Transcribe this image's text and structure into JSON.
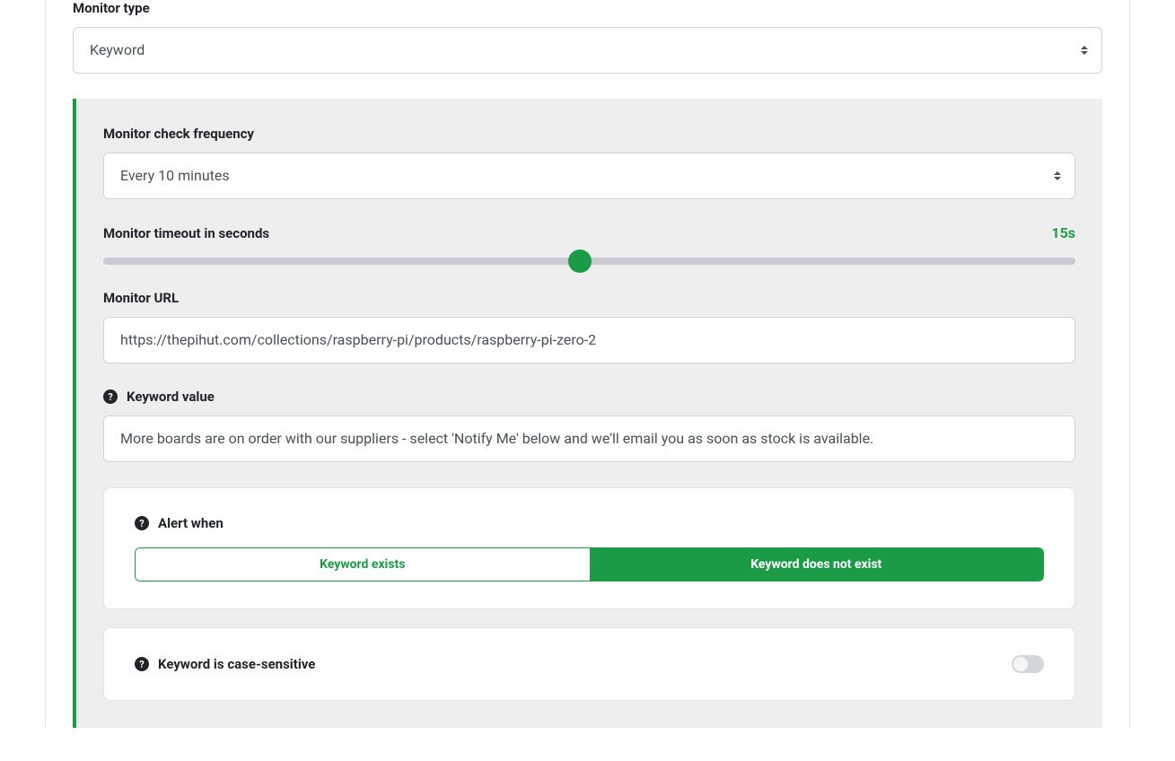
{
  "monitor_type": {
    "label": "Monitor type",
    "value": "Keyword"
  },
  "frequency": {
    "label": "Monitor check frequency",
    "value": "Every 10 minutes"
  },
  "timeout": {
    "label": "Monitor timeout in seconds",
    "value_display": "15s",
    "percent": 49
  },
  "url": {
    "label": "Monitor URL",
    "value": "https://thepihut.com/collections/raspberry-pi/products/raspberry-pi-zero-2"
  },
  "keyword": {
    "label": "Keyword value",
    "value": "More boards are on order with our suppliers - select 'Notify Me' below and we'll email you as soon as stock is available."
  },
  "alert_when": {
    "label": "Alert when",
    "option_exists": "Keyword exists",
    "option_not_exist": "Keyword does not exist",
    "selected": "not_exist"
  },
  "case_sensitive": {
    "label": "Keyword is case-sensitive",
    "value": false
  }
}
